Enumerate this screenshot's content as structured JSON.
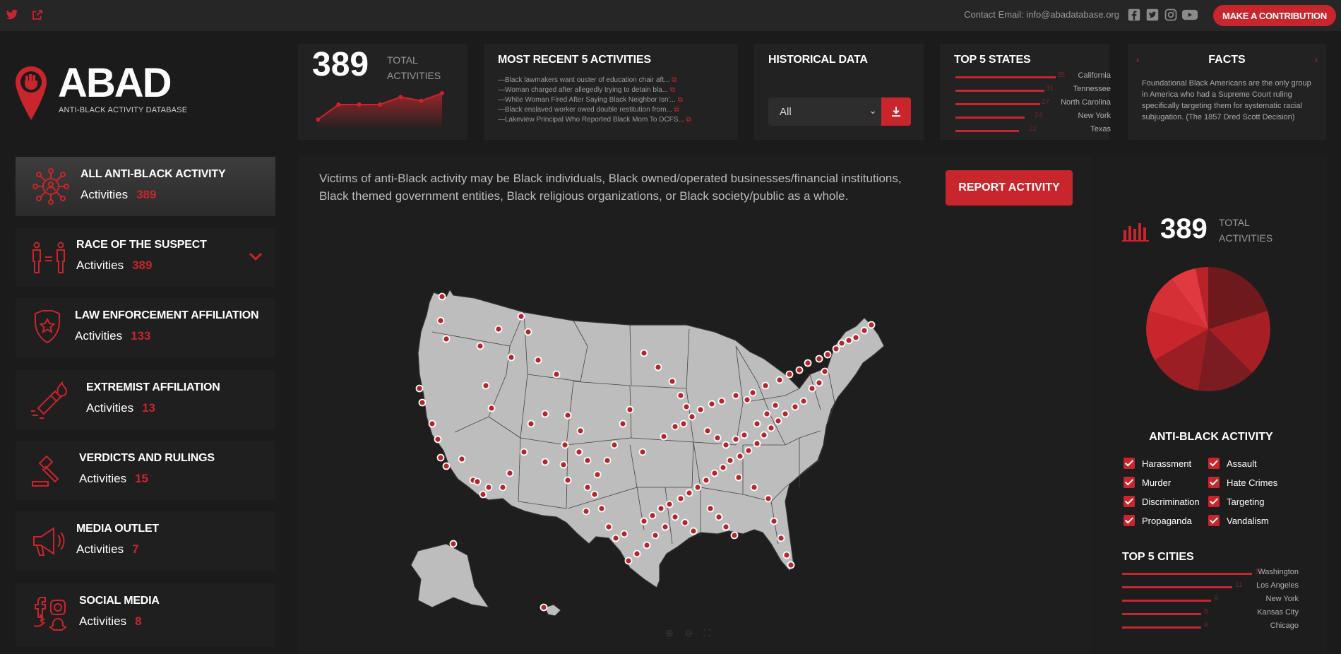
{
  "topbar": {
    "contact": "Contact Email: info@abadatabase.org",
    "contribute_label": "MAKE A CONTRIBUTION",
    "icons": [
      "twitter-icon",
      "external-link-icon",
      "facebook-icon",
      "twitter-icon",
      "instagram-icon",
      "youtube-icon"
    ]
  },
  "logo": {
    "title": "ABAD",
    "subtitle": "ANTI-BLACK ACTIVITY DATABASE"
  },
  "total_card": {
    "value": "389",
    "label_1": "TOTAL",
    "label_2": "ACTIVITIES",
    "sparkline": [
      2,
      6,
      6,
      6,
      8,
      7,
      9
    ]
  },
  "recent": {
    "title": "MOST RECENT 5 ACTIVITIES",
    "items": [
      "—Black lawmakers want ouster of education chair aft...",
      "—Woman charged after allegedly trying to detain bla...",
      "—White Woman Fired After Saying Black Neighbor Isn'...",
      "—Black enslaved worker owed double restitution from...",
      "—Lakeview Principal Who Reported Black Mom To DCFS..."
    ]
  },
  "historical": {
    "title": "HISTORICAL DATA",
    "selected": "All"
  },
  "top_states": {
    "title": "TOP 5 STATES",
    "items": [
      {
        "name": "California",
        "value": "35"
      },
      {
        "name": "Tennessee",
        "value": "31"
      },
      {
        "name": "North Carolina",
        "value": "27"
      },
      {
        "name": "New York",
        "value": "24"
      },
      {
        "name": "Texas",
        "value": "22"
      }
    ]
  },
  "facts": {
    "title": "FACTS",
    "text": "Foundational Black Americans are the only group in America who had a Supreme Court ruling specifically targeting them for systematic racial subjugation. (The 1857 Dred Scott Decision)"
  },
  "sidebar": {
    "activities_label": "Activities",
    "items": [
      {
        "title": "ALL ANTI-BLACK ACTIVITY",
        "count": "389"
      },
      {
        "title": "RACE OF THE SUSPECT",
        "count": "389"
      },
      {
        "title": "LAW ENFORCEMENT AFFILIATION",
        "count": "133"
      },
      {
        "title": "EXTREMIST AFFILIATION",
        "count": "13"
      },
      {
        "title": "VERDICTS AND RULINGS",
        "count": "15"
      },
      {
        "title": "MEDIA OUTLET",
        "count": "7"
      },
      {
        "title": "SOCIAL MEDIA",
        "count": "8"
      }
    ]
  },
  "main": {
    "intro": "Victims of anti-Black activity may be Black individuals, Black owned/operated businesses/financial institutions, Black themed government entities, Black religious organizations, or Black society/public as a whole.",
    "report_label": "REPORT ACTIVITY"
  },
  "right_panel": {
    "total_value": "389",
    "label_1": "TOTAL",
    "label_2": "ACTIVITIES",
    "activity_title": "ANTI-BLACK ACTIVITY",
    "categories": [
      "Harassment",
      "Assault",
      "Murder",
      "Hate Crimes",
      "Discrimination",
      "Targeting",
      "Propaganda",
      "Vandalism"
    ],
    "cities_title": "TOP 5 CITIES",
    "cities": [
      {
        "name": "Washington",
        "value": "13"
      },
      {
        "name": "Los Angeles",
        "value": "11"
      },
      {
        "name": "New York",
        "value": "9"
      },
      {
        "name": "Kansas City",
        "value": "8"
      },
      {
        "name": "Chicago",
        "value": "8"
      }
    ]
  },
  "colors": {
    "accent": "#c8252c",
    "background": "#1b1b1b",
    "card": "#222222",
    "map_land": "#bdbdbd"
  }
}
